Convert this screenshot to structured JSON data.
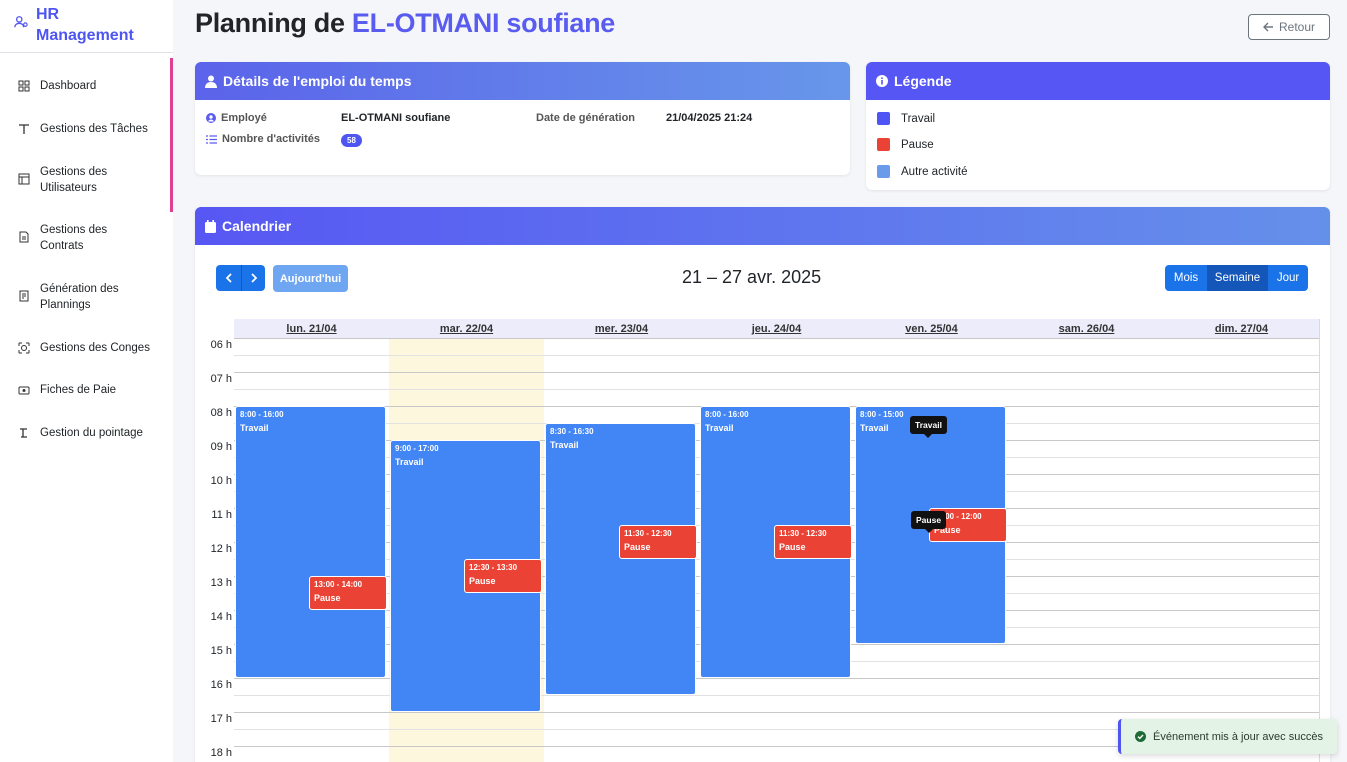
{
  "app": {
    "brand": "HR Management"
  },
  "sidebar": {
    "items": [
      {
        "label": "Dashboard",
        "icon": "dashboard-icon"
      },
      {
        "label": "Gestions des Tâches",
        "icon": "tasks-icon"
      },
      {
        "label": "Gestions des Utilisateurs",
        "icon": "users-icon"
      },
      {
        "label": "Gestions des Contrats",
        "icon": "contract-icon"
      },
      {
        "label": "Génération des Plannings",
        "icon": "planning-icon"
      },
      {
        "label": "Gestions des Conges",
        "icon": "leave-icon"
      },
      {
        "label": "Fiches de Paie",
        "icon": "payslip-icon"
      },
      {
        "label": "Gestion du pointage",
        "icon": "clock-icon"
      }
    ]
  },
  "header": {
    "title_prefix": "Planning de",
    "employee_name": "EL-OTMANI soufiane",
    "back_label": "Retour"
  },
  "details": {
    "title": "Détails de l'emploi du temps",
    "employee_label": "Employé",
    "employee_value": "EL-OTMANI soufiane",
    "activities_label": "Nombre d'activités",
    "activities_value": "58",
    "generation_label": "Date de génération",
    "generation_value": "21/04/2025 21:24"
  },
  "legend": {
    "title": "Légende",
    "items": [
      {
        "label": "Travail",
        "color": "#4e55f4"
      },
      {
        "label": "Pause",
        "color": "#ea4335"
      },
      {
        "label": "Autre activité",
        "color": "#6a9bea"
      }
    ]
  },
  "calendar": {
    "title": "Calendrier",
    "today_label": "Aujourd'hui",
    "range": "21 – 27 avr. 2025",
    "views": [
      "Mois",
      "Semaine",
      "Jour"
    ],
    "active_view": "Semaine",
    "days": [
      "lun. 21/04",
      "mar. 22/04",
      "mer. 23/04",
      "jeu. 24/04",
      "ven. 25/04",
      "sam. 26/04",
      "dim. 27/04"
    ],
    "today_index": 1,
    "hours": [
      "06 h",
      "07 h",
      "08 h",
      "09 h",
      "10 h",
      "11 h",
      "12 h",
      "13 h",
      "14 h",
      "15 h",
      "16 h",
      "17 h",
      "18 h"
    ],
    "events": [
      {
        "day": 0,
        "time": "8:00 - 16:00",
        "title": "Travail",
        "type": "work"
      },
      {
        "day": 0,
        "time": "13:00 - 14:00",
        "title": "Pause",
        "type": "pause"
      },
      {
        "day": 1,
        "time": "9:00 - 17:00",
        "title": "Travail",
        "type": "work"
      },
      {
        "day": 1,
        "time": "12:30 - 13:30",
        "title": "Pause",
        "type": "pause"
      },
      {
        "day": 2,
        "time": "8:30 - 16:30",
        "title": "Travail",
        "type": "work"
      },
      {
        "day": 2,
        "time": "11:30 - 12:30",
        "title": "Pause",
        "type": "pause"
      },
      {
        "day": 3,
        "time": "8:00 - 16:00",
        "title": "Travail",
        "type": "work"
      },
      {
        "day": 3,
        "time": "11:30 - 12:30",
        "title": "Pause",
        "type": "pause"
      },
      {
        "day": 4,
        "time": "8:00 - 15:00",
        "title": "Travail",
        "type": "work"
      },
      {
        "day": 4,
        "time": "11:00 - 12:00",
        "title": "Pause",
        "type": "pause"
      }
    ],
    "tooltips": [
      "Travail",
      "Pause"
    ]
  },
  "toast": {
    "message": "Événement mis à jour avec succès"
  }
}
